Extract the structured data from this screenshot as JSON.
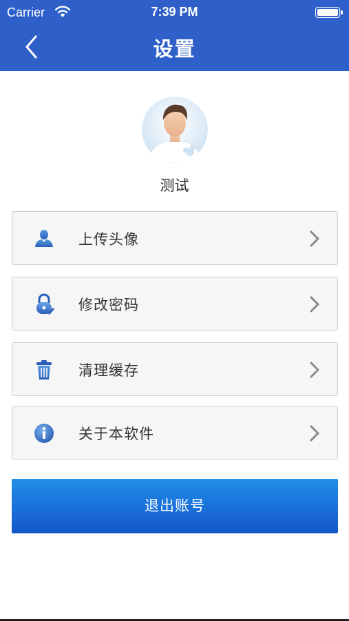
{
  "status_bar": {
    "carrier": "Carrier",
    "time": "7:39 PM"
  },
  "nav": {
    "title": "设置",
    "back_icon": "chevron-left-icon"
  },
  "profile": {
    "name": "测试",
    "avatar_icon": "user-avatar"
  },
  "menu": [
    {
      "label": "上传头像",
      "icon": "user-icon"
    },
    {
      "label": "修改密码",
      "icon": "lock-icon"
    },
    {
      "label": "清理缓存",
      "icon": "trash-icon"
    },
    {
      "label": "关于本软件",
      "icon": "info-icon"
    }
  ],
  "logout_label": "退出账号",
  "colors": {
    "nav_bg": "#2f5fc9",
    "accent_blue": "#1a6fda",
    "row_bg": "#f6f6f6"
  }
}
